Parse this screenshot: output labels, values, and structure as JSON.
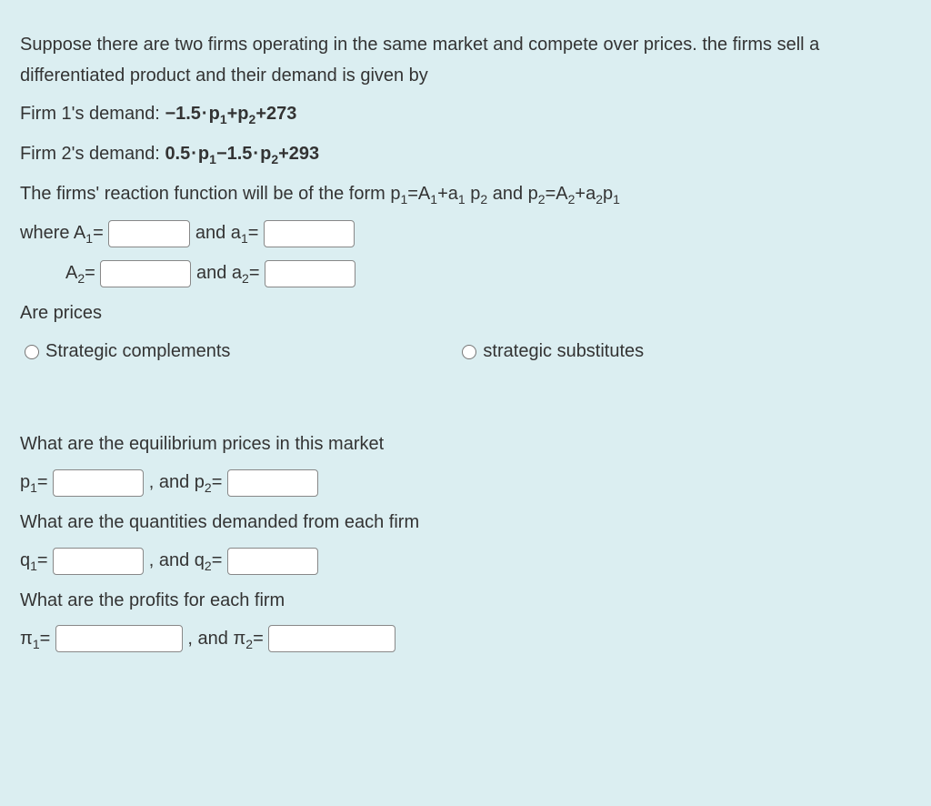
{
  "intro": "Suppose there are two firms operating in the same market and compete over prices. the firms sell a differentiated product and their demand is given by",
  "firm1_demand_label": "Firm 1's demand: ",
  "firm1_demand_expr": "−1.5·p₁+p₂+273",
  "firm2_demand_label": "Firm 2's demand: ",
  "firm2_demand_expr": "0.5·p₁−1.5·p₂+293",
  "reaction_line_pre": "The firms' reaction function will be of the form p",
  "reaction_line_mid1": "=A",
  "reaction_line_mid2": "+a",
  "reaction_line_mid3": " p",
  "reaction_line_and": " and p",
  "reaction_line_mid4": "=A",
  "reaction_line_mid5": "+a",
  "reaction_line_mid6": "p",
  "labels": {
    "where": "where A",
    "and_a1": " and a",
    "A2": "A",
    "and_a2": " and a",
    "eq": "="
  },
  "are_prices": "Are prices",
  "opt_complements": "Strategic complements",
  "opt_substitutes": "strategic substitutes",
  "q_eq_prices": "What are the equilibrium prices in this market",
  "p1_label": "p",
  "and_p2": ", and p",
  "q_quantities": "What are the quantities demanded from each firm",
  "q1_label": "q",
  "and_q2": ", and q",
  "q_profits": "What are the profits for each firm",
  "pi1_label": "π",
  "and_pi2": ", and π",
  "sub1": "1",
  "sub2": "2"
}
